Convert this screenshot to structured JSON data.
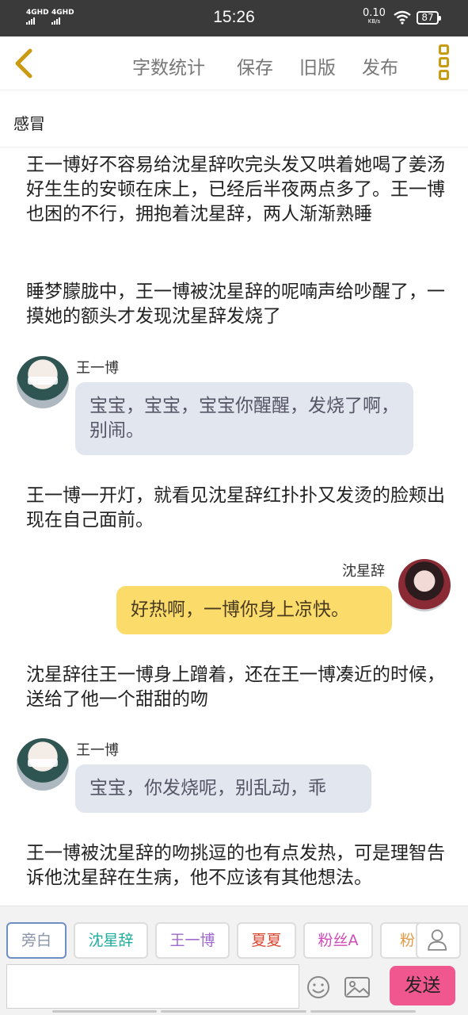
{
  "status_bar": {
    "network1": "4GHD",
    "network2": "4GHD",
    "time": "15:26",
    "speed_value": "0.10",
    "speed_unit": "KB/s",
    "battery": "87"
  },
  "nav": {
    "word_count": "字数统计",
    "save": "保存",
    "old_version": "旧版",
    "publish": "发布"
  },
  "doc_title": "感冒",
  "content": {
    "p1": "王一博好不容易给沈星辞吹完头发又哄着她喝了姜汤好生生的安顿在床上，已经后半夜两点多了。王一博也困的不行，拥抱着沈星辞，两人渐渐熟睡",
    "p2": "睡梦朦胧中，王一博被沈星辞的呢喃声给吵醒了，一摸她的额头才发现沈星辞发烧了",
    "speaker1": "王一博",
    "bubble1": "宝宝，宝宝，宝宝你醒醒，发烧了啊，别闹。",
    "p3": "王一博一开灯，就看见沈星辞红扑扑又发烫的脸颊出现在自己面前。",
    "speaker2": "沈星辞",
    "bubble2": "好热啊，一博你身上凉快。",
    "p4": "沈星辞往王一博身上蹭着，还在王一博凑近的时候，送给了他一个甜甜的吻",
    "speaker3": "王一博",
    "bubble3": "宝宝，你发烧呢，别乱动，乖",
    "p5": "王一博被沈星辞的吻挑逗的也有点发热，可是理智告诉他沈星辞在生病，他不应该有其他想法。"
  },
  "roles": [
    {
      "label": "旁白",
      "color": "#8a93a8",
      "border": "#6f8fc4"
    },
    {
      "label": "沈星辞",
      "color": "#1fae9e",
      "border": "#dddddd"
    },
    {
      "label": "王一博",
      "color": "#a06ad0",
      "border": "#dddddd"
    },
    {
      "label": "夏夏",
      "color": "#d9452f",
      "border": "#dddddd"
    },
    {
      "label": "粉丝A",
      "color": "#d04ab8",
      "border": "#dddddd"
    },
    {
      "label": "粉丝",
      "color": "#e39a45",
      "border": "#dddddd"
    }
  ],
  "input": {
    "value": "",
    "placeholder": ""
  },
  "send_label": "发送",
  "icons": {
    "back": "chevron-left-icon",
    "more": "more-vertical-icon",
    "user": "user-icon",
    "emoji": "emoji-icon",
    "image": "image-icon",
    "wifi": "wifi-icon"
  },
  "colors": {
    "accent_gold": "#c99a12",
    "send_pink": "#f0578f",
    "bubble_left": "#e2e6ee",
    "bubble_right": "#fbdc6a"
  }
}
